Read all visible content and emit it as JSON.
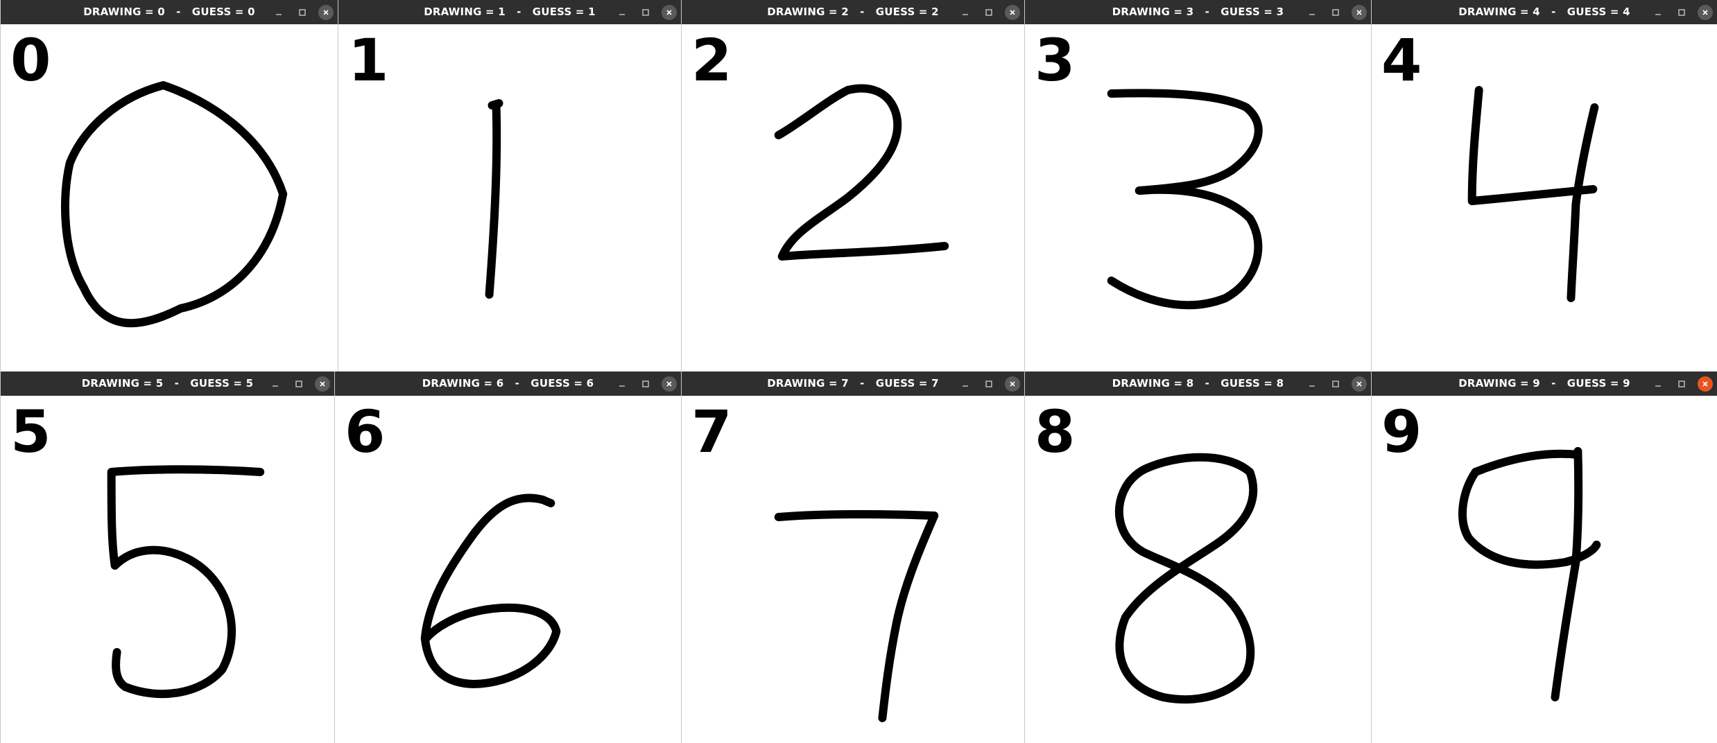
{
  "windows": [
    {
      "title": "DRAWING = 0   -   GUESS = 0",
      "label": "0",
      "digit": "0",
      "close_active": false
    },
    {
      "title": "DRAWING = 1   -   GUESS = 1",
      "label": "1",
      "digit": "1",
      "close_active": false
    },
    {
      "title": "DRAWING = 2   -   GUESS = 2",
      "label": "2",
      "digit": "2",
      "close_active": false
    },
    {
      "title": "DRAWING = 3   -   GUESS = 3",
      "label": "3",
      "digit": "3",
      "close_active": false
    },
    {
      "title": "DRAWING = 4   -   GUESS = 4",
      "label": "4",
      "digit": "4",
      "close_active": false
    },
    {
      "title": "DRAWING = 5   -   GUESS = 5",
      "label": "5",
      "digit": "5",
      "close_active": false
    },
    {
      "title": "DRAWING = 6   -   GUESS = 6",
      "label": "6",
      "digit": "6",
      "close_active": false
    },
    {
      "title": "DRAWING = 7   -   GUESS = 7",
      "label": "7",
      "digit": "7",
      "close_active": false
    },
    {
      "title": "DRAWING = 8   -   GUESS = 8",
      "label": "8",
      "digit": "8",
      "close_active": false
    },
    {
      "title": "DRAWING = 9   -   GUESS = 9",
      "label": "9",
      "digit": "9",
      "close_active": true
    }
  ],
  "icons": {
    "minimize": "minimize-icon",
    "maximize": "maximize-icon",
    "close": "close-icon"
  },
  "colors": {
    "titlebar": "#2f2f2f",
    "close_active": "#e9541f",
    "close_inactive": "#5a5a5a",
    "canvas": "#ffffff",
    "ink": "#000000"
  }
}
